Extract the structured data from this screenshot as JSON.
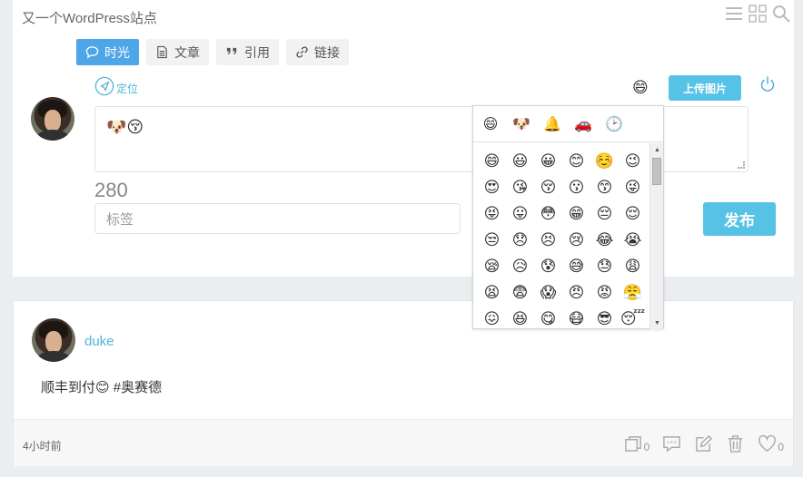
{
  "site": {
    "title": "又一个WordPress站点"
  },
  "composer": {
    "tabs": [
      {
        "label": "时光",
        "icon": "speech-bubble-icon",
        "active": true
      },
      {
        "label": "文章",
        "icon": "document-icon",
        "active": false
      },
      {
        "label": "引用",
        "icon": "quote-icon",
        "active": false
      },
      {
        "label": "链接",
        "icon": "link-icon",
        "active": false
      }
    ],
    "locate_label": "定位",
    "upload_label": "上传图片",
    "editor_content": "🐶😚",
    "char_count": "280",
    "tag_placeholder": "标签",
    "publish_label": "发布"
  },
  "emoji_panel": {
    "categories": [
      "😄",
      "🐶",
      "🔔",
      "🚗",
      "🕑"
    ],
    "emojis": [
      "😄",
      "😃",
      "😀",
      "😊",
      "☺️",
      "😉",
      "😍",
      "😘",
      "😚",
      "😗",
      "😙",
      "😜",
      "😝",
      "😛",
      "😳",
      "😁",
      "😔",
      "😌",
      "😒",
      "😞",
      "😣",
      "😢",
      "😂",
      "😭",
      "😪",
      "😥",
      "😰",
      "😅",
      "😓",
      "😩",
      "😫",
      "😨",
      "😱",
      "😠",
      "😡",
      "😤",
      "😖",
      "😆",
      "😋",
      "😷",
      "😎",
      "😴"
    ]
  },
  "post": {
    "author": "duke",
    "content": "顺丰到付😊 #奥赛德",
    "time": "4小时前",
    "actions": [
      {
        "icon": "repost-icon",
        "count": "0"
      },
      {
        "icon": "comment-icon",
        "count": ""
      },
      {
        "icon": "edit-icon",
        "count": ""
      },
      {
        "icon": "trash-icon",
        "count": ""
      },
      {
        "icon": "heart-icon",
        "count": "0"
      }
    ]
  },
  "colors": {
    "accent": "#56c2e6",
    "tab_active": "#4da6e8",
    "link": "#4fb3d9"
  }
}
